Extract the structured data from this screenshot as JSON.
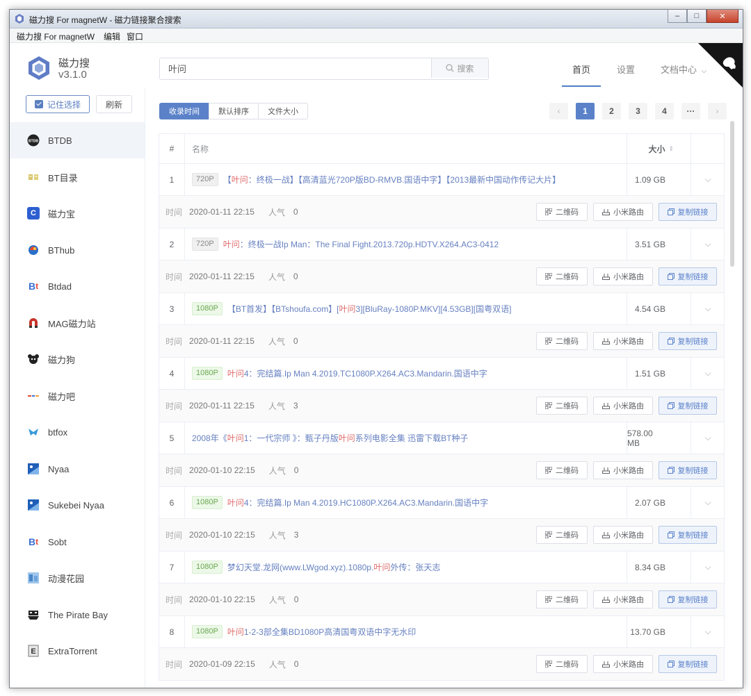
{
  "window": {
    "title": "磁力搜 For magnetW - 磁力链接聚合搜索",
    "controls": [
      "minimize",
      "maximize",
      "close"
    ]
  },
  "menubar": [
    "磁力搜 For magnetW",
    "编辑",
    "窗口"
  ],
  "app": {
    "name": "磁力搜",
    "version": "v3.1.0"
  },
  "search": {
    "value": "叶问",
    "button_label": "搜索"
  },
  "nav": [
    {
      "label": "首页",
      "active": true
    },
    {
      "label": "设置",
      "active": false
    },
    {
      "label": "文档中心",
      "active": false
    }
  ],
  "sidebar": {
    "remember_label": "记住选择",
    "refresh_label": "刷新",
    "sites": [
      {
        "label": "BTDB",
        "icon": "btdb-icon",
        "active": true
      },
      {
        "label": "BT目录",
        "icon": "bt-catalog-icon"
      },
      {
        "label": "磁力宝",
        "icon": "cilibao-icon"
      },
      {
        "label": "BThub",
        "icon": "bthub-icon"
      },
      {
        "label": "Btdad",
        "icon": "btdad-icon"
      },
      {
        "label": "MAG磁力站",
        "icon": "magnet-icon"
      },
      {
        "label": "磁力狗",
        "icon": "dog-icon"
      },
      {
        "label": "磁力吧",
        "icon": "cili8-icon"
      },
      {
        "label": "btfox",
        "icon": "fox-icon"
      },
      {
        "label": "Nyaa",
        "icon": "nyaa-icon"
      },
      {
        "label": "Sukebei Nyaa",
        "icon": "sukebei-icon"
      },
      {
        "label": "Sobt",
        "icon": "sobt-icon"
      },
      {
        "label": "动漫花园",
        "icon": "dmhy-icon"
      },
      {
        "label": "The Pirate Bay",
        "icon": "pirate-ship-icon"
      },
      {
        "label": "ExtraTorrent",
        "icon": "extratorrent-icon"
      }
    ]
  },
  "sort": {
    "options": [
      "收录时间",
      "默认排序",
      "文件大小"
    ],
    "active": 0
  },
  "pagination": {
    "pages": [
      "1",
      "2",
      "3",
      "4",
      "···"
    ],
    "current": 1
  },
  "table": {
    "headers": {
      "index": "#",
      "name": "名称",
      "size": "大小"
    },
    "time_label": "时间",
    "popularity_label": "人气",
    "actions": {
      "qr": "二维码",
      "xiaomi": "小米路由",
      "copy": "复制链接"
    },
    "rows": [
      {
        "index": "1",
        "tag": "720P",
        "name": [
          [
            "【",
            false
          ],
          [
            "叶问",
            true
          ],
          [
            "：终极一战】【高清蓝光720P版BD-RMVB.国语中字】【2013最新中国动作传记大片】",
            false
          ]
        ],
        "size": "1.09 GB",
        "date": "2020-01-11 22:15",
        "popularity": "0"
      },
      {
        "index": "2",
        "tag": "720P",
        "name": [
          [
            "叶问",
            true
          ],
          [
            "：终极一战Ip Man：The Final Fight.2013.720p.HDTV.X264.AC3-0412",
            false
          ]
        ],
        "size": "3.51 GB",
        "date": "2020-01-11 22:15",
        "popularity": "0"
      },
      {
        "index": "3",
        "tag": "1080P",
        "name": [
          [
            "【BT首发】【BTshoufa.com】[",
            false
          ],
          [
            "叶问",
            true
          ],
          [
            "3][BluRay-1080P.MKV][4.53GB][国粤双语]",
            false
          ]
        ],
        "size": "4.54 GB",
        "date": "2020-01-11 22:15",
        "popularity": "0"
      },
      {
        "index": "4",
        "tag": "1080P",
        "name": [
          [
            "叶问",
            true
          ],
          [
            "4：完结篇.Ip Man 4.2019.TC1080P.X264.AC3.Mandarin.国语中字",
            false
          ]
        ],
        "size": "1.51 GB",
        "date": "2020-01-11 22:15",
        "popularity": "3"
      },
      {
        "index": "5",
        "tag": "",
        "name": [
          [
            "2008年《",
            false
          ],
          [
            "叶问",
            true
          ],
          [
            "1：一代宗师 》：甄子丹版 ",
            false
          ],
          [
            "叶问",
            true
          ],
          [
            "系列电影全集 迅雷下载BT种子",
            false
          ]
        ],
        "size": "578.00 MB",
        "date": "2020-01-10 22:15",
        "popularity": "0"
      },
      {
        "index": "6",
        "tag": "1080P",
        "name": [
          [
            "叶问",
            true
          ],
          [
            "4：完结篇.Ip Man 4.2019.HC1080P.X264.AC3.Mandarin.国语中字",
            false
          ]
        ],
        "size": "2.07 GB",
        "date": "2020-01-10 22:15",
        "popularity": "3"
      },
      {
        "index": "7",
        "tag": "1080P",
        "name": [
          [
            "梦幻天堂.龙网(www.LWgod.xyz).1080p.",
            false
          ],
          [
            "叶问",
            true
          ],
          [
            "外传：张天志",
            false
          ]
        ],
        "size": "8.34 GB",
        "date": "2020-01-10 22:15",
        "popularity": "0"
      },
      {
        "index": "8",
        "tag": "1080P",
        "name": [
          [
            "叶问",
            true
          ],
          [
            "1-2-3部全集BD1080P高清国粤双语中字无水印",
            false
          ]
        ],
        "size": "13.70 GB",
        "date": "2020-01-09 22:15",
        "popularity": "0"
      }
    ]
  },
  "colors": {
    "accent": "#5b82c9",
    "highlight": "#e06a6a",
    "link": "#6680c0"
  }
}
